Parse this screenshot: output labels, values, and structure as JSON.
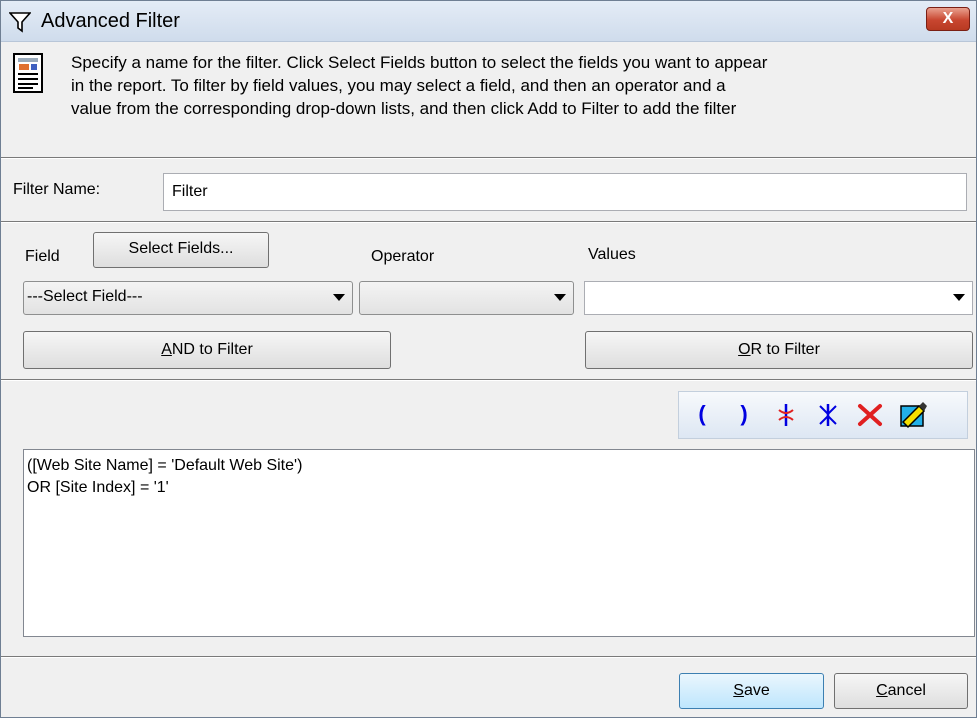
{
  "window": {
    "title": "Advanced Filter",
    "close_label": "X"
  },
  "instructions": {
    "line1": "Specify a name for the filter. Click Select Fields button to select the fields you want to appear",
    "line2": "in the report. To filter by field values, you may select a field, and then an operator and a",
    "line3": "value from the corresponding drop-down lists, and then click Add to Filter to add the filter"
  },
  "filter_name": {
    "label": "Filter Name:",
    "value": "Filter"
  },
  "field": {
    "label": "Field",
    "select_button": "Select Fields...",
    "selected": "---Select Field---"
  },
  "operator": {
    "label": "Operator",
    "selected": ""
  },
  "values": {
    "label": "Values",
    "selected": ""
  },
  "and_button": {
    "mnemonic": "A",
    "rest": "ND to Filter"
  },
  "or_button": {
    "mnemonic": "O",
    "rest": "R to Filter"
  },
  "toolbar": {
    "open_paren": "(",
    "close_paren": ")",
    "items": [
      "open-parenthesis-icon",
      "close-parenthesis-icon",
      "insert-and-icon",
      "insert-or-icon",
      "delete-icon",
      "clear-icon"
    ]
  },
  "expression": {
    "line1": "([Web Site Name] = 'Default Web Site')",
    "line2": "OR  [Site Index] = '1'"
  },
  "buttons": {
    "save": {
      "mnemonic": "S",
      "rest": "ave"
    },
    "cancel": {
      "mnemonic": "C",
      "rest": "ancel"
    }
  },
  "colors": {
    "title_bar": "#d6e2f0",
    "close_button": "#c84630",
    "toolbar_blue": "#0000e0",
    "delete_red": "#e02020"
  }
}
